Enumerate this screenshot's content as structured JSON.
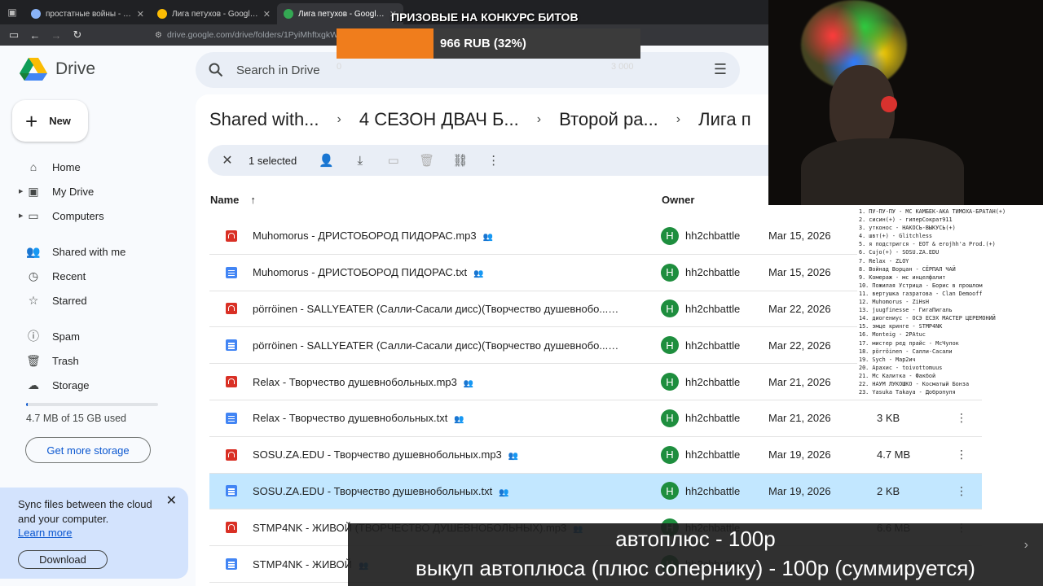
{
  "browser": {
    "tabs": [
      {
        "title": "простатные войны - Google Sh",
        "favicon_color": "#8ab4f8",
        "active": false
      },
      {
        "title": "Лига петухов - Google Drive",
        "favicon_color": "#fbbc04",
        "active": false
      },
      {
        "title": "Лига петухов - Google Drive",
        "favicon_color": "#34a853",
        "active": true
      }
    ],
    "url": "drive.google.com/drive/folders/1PyiMhftxgkW9"
  },
  "drive": {
    "logo_text": "Drive",
    "search_placeholder": "Search in Drive",
    "new_label": "New",
    "nav": [
      {
        "label": "Home",
        "icon": "home-icon",
        "glyph": "⌂",
        "caret": false
      },
      {
        "label": "My Drive",
        "icon": "my-drive-icon",
        "glyph": "▣",
        "caret": true
      },
      {
        "label": "Computers",
        "icon": "computer-icon",
        "glyph": "▭",
        "caret": true
      },
      {
        "gap": true
      },
      {
        "label": "Shared with me",
        "icon": "people-icon",
        "glyph": "👥",
        "caret": false
      },
      {
        "label": "Recent",
        "icon": "clock-icon",
        "glyph": "◷",
        "caret": false
      },
      {
        "label": "Starred",
        "icon": "star-icon",
        "glyph": "☆",
        "caret": false
      },
      {
        "gap": true
      },
      {
        "label": "Spam",
        "icon": "spam-icon",
        "glyph": "ⓘ",
        "caret": false
      },
      {
        "label": "Trash",
        "icon": "trash-icon",
        "glyph": "🗑",
        "caret": false
      },
      {
        "label": "Storage",
        "icon": "cloud-icon",
        "glyph": "☁",
        "caret": false
      }
    ],
    "storage": {
      "used_text": "4.7 MB of 15 GB used",
      "fraction": 0.0003,
      "button": "Get more storage"
    },
    "sync": {
      "message": "Sync files between the cloud and your computer.",
      "learn_more": "Learn more",
      "download": "Download"
    },
    "breadcrumbs": [
      "Shared with...",
      "4 СЕЗОН ДВАЧ Б...",
      "Второй ра...",
      "Лига п"
    ],
    "selection": {
      "count_text": "1 selected"
    },
    "columns": {
      "name": "Name",
      "owner": "Owner"
    },
    "files": [
      {
        "name": "Muhomorus - ДРИСТОБОРОД ПИДОРАС.mp3",
        "type": "audio",
        "owner": "hh2chbattle",
        "date": "Mar 15, 2026",
        "size": "",
        "selected": false
      },
      {
        "name": "Muhomorus - ДРИСТОБОРОД ПИДОРАС.txt",
        "type": "doc",
        "owner": "hh2chbattle",
        "date": "Mar 15, 2026",
        "size": "",
        "selected": false
      },
      {
        "name": "pörröinen - SALLYEATER (Салли-Сасали дисс)(Творчество душевнобо...",
        "type": "audio",
        "owner": "hh2chbattle",
        "date": "Mar 22, 2026",
        "size": "",
        "selected": false
      },
      {
        "name": "pörröinen - SALLYEATER (Салли-Сасали дисс)(Творчество душевнобо...",
        "type": "doc",
        "owner": "hh2chbattle",
        "date": "Mar 22, 2026",
        "size": "",
        "selected": false
      },
      {
        "name": "Relax - Творчество душевнобольных.mp3",
        "type": "audio",
        "owner": "hh2chbattle",
        "date": "Mar 21, 2026",
        "size": "",
        "selected": false
      },
      {
        "name": "Relax - Творчество душевнобольных.txt",
        "type": "doc",
        "owner": "hh2chbattle",
        "date": "Mar 21, 2026",
        "size": "3 KB",
        "selected": false
      },
      {
        "name": "SOSU.ZA.EDU - Творчество душевнобольных.mp3",
        "type": "audio",
        "owner": "hh2chbattle",
        "date": "Mar 19, 2026",
        "size": "4.7 MB",
        "selected": false
      },
      {
        "name": "SOSU.ZA.EDU - Творчество душевнобольных.txt",
        "type": "doc",
        "owner": "hh2chbattle",
        "date": "Mar 19, 2026",
        "size": "2 KB",
        "selected": true
      },
      {
        "name": "STMP4NK - ЖИВОЙ (ТВОРЧЕСТВО ДУШЕВНОБОЛЬНЫХ).mp3",
        "type": "audio",
        "owner": "hh2chbattle",
        "date": "",
        "size": "6.6 MB",
        "selected": false
      },
      {
        "name": "STMP4NK - ЖИВОЙ",
        "type": "doc",
        "owner": "hh2chbattle",
        "date": "",
        "size": "",
        "selected": false
      }
    ]
  },
  "overlay": {
    "prize_title": "ПРИЗОВЫЕ НА КОНКУРС БИТОВ",
    "prize_text": "966 RUB (32%)",
    "prize_fraction": 0.32,
    "prize_min": "0",
    "prize_max": "3 000",
    "list": [
      "1. ПУ-ПУ-ПУ - МС КАМБЕК-АКА ТИМОХА-БРАТАН(+)",
      "2. сисин(+) - гиперСократ911",
      "3. утконос - НАКОСЬ-ВЫКУСЬ(+)",
      "4. швт(+) - Glitchless",
      "5. я подстригся - EOT & erojhh'a Prod.(+)",
      "6. Cujo(+) - SOSU.ZA.EDU",
      "7. Relax - ZLOY",
      "8. Войнад Ворцан - СЁРПАЛ ЧАЙ",
      "9. Комераж - мс инцелфалит",
      "10. Пожилая Устрица - Борис в прошлом",
      "11. вертушка газратова - Clan Demooff",
      "12. Muhomorus - ZiHsH",
      "13. juugfinesse - ГигаПигаль",
      "14. диогениус - ОСЭ ЕСЭХ МАСТЕР ЦЕРЕМОНИЙ",
      "15. эмце кринге - STMP4NK",
      "16. Monteig - 2PAtuc",
      "17. мистер ред прайс - МсЧулок",
      "18. pörröinen - Салли-Сасали",
      "19. Sych - Мар2ич",
      "20. Арахис - toivottomuus",
      "21. Мс Калитка - Факбой",
      "22. НАУМ ЛУКОШКО - Косматый Бонза",
      "23. Yasuka Takaya - Добропуля"
    ],
    "subtitle_line1": "автоплюс - 100р",
    "subtitle_line2": "выкуп автоплюса (плюс сопернику) - 100р (суммируется)"
  }
}
